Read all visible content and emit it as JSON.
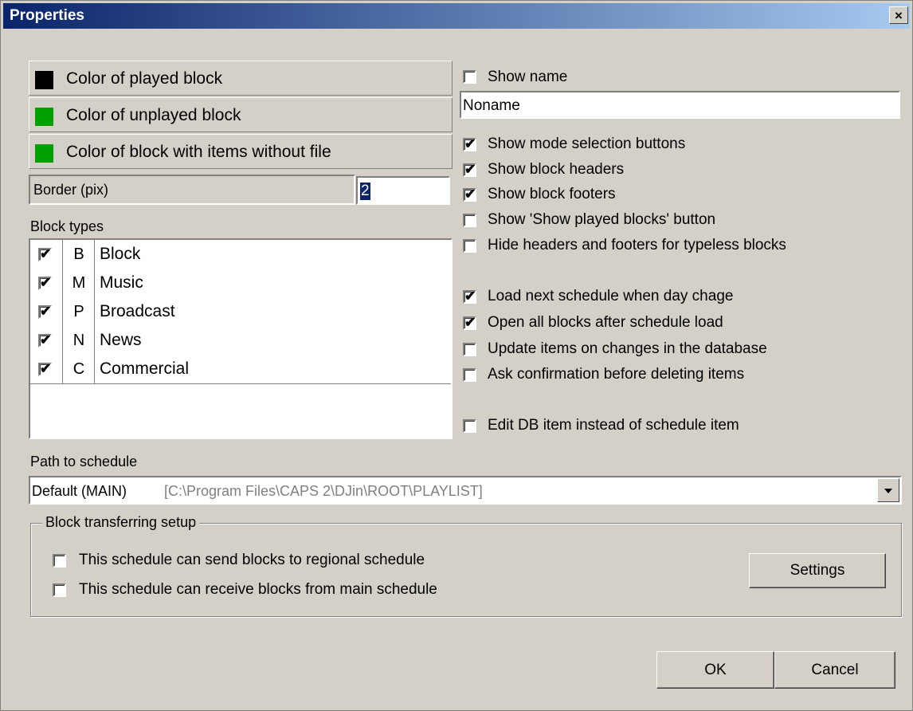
{
  "window": {
    "title": "Properties",
    "close_glyph": "×"
  },
  "colors": {
    "played": {
      "label": "Color of played block",
      "swatch": "#000000"
    },
    "unplayed": {
      "label": "Color of unplayed block",
      "swatch": "#00a000"
    },
    "without_file": {
      "label": "Color of block with items without file",
      "swatch": "#00a000"
    }
  },
  "border": {
    "label": "Border (pix)",
    "value": "2"
  },
  "block_types": {
    "label": "Block types",
    "rows": [
      {
        "checked": true,
        "code": "B",
        "name": "Block"
      },
      {
        "checked": true,
        "code": "M",
        "name": "Music"
      },
      {
        "checked": true,
        "code": "P",
        "name": "Broadcast"
      },
      {
        "checked": true,
        "code": "N",
        "name": "News"
      },
      {
        "checked": true,
        "code": "C",
        "name": "Commercial"
      }
    ]
  },
  "options": {
    "show_name": {
      "label": "Show name",
      "checked": false
    },
    "name_value": "Noname",
    "mode_buttons": {
      "label": "Show mode selection buttons",
      "checked": true
    },
    "block_headers": {
      "label": "Show block headers",
      "checked": true
    },
    "block_footers": {
      "label": "Show block footers",
      "checked": true
    },
    "played_button": {
      "label": "Show 'Show played blocks' button",
      "checked": false
    },
    "hide_typeless": {
      "label": "Hide headers and footers for typeless blocks",
      "checked": false
    },
    "load_next": {
      "label": "Load next schedule when day chage",
      "checked": true
    },
    "open_all": {
      "label": "Open all blocks after schedule load",
      "checked": true
    },
    "update_items": {
      "label": "Update items on changes in the database",
      "checked": false
    },
    "ask_confirm": {
      "label": "Ask confirmation before deleting items",
      "checked": false
    },
    "edit_db": {
      "label": "Edit DB item instead of schedule item",
      "checked": false
    }
  },
  "schedule": {
    "label": "Path to schedule",
    "value": "Default (MAIN)",
    "path": "[C:\\Program Files\\CAPS 2\\DJin\\ROOT\\PLAYLIST]"
  },
  "transfer": {
    "legend": "Block transferring setup",
    "send": {
      "label": "This schedule can send blocks to regional schedule",
      "checked": false
    },
    "receive": {
      "label": "This schedule can receive blocks from main schedule",
      "checked": false
    },
    "settings": "Settings"
  },
  "buttons": {
    "ok": "OK",
    "cancel": "Cancel"
  },
  "check_glyph": "✔"
}
